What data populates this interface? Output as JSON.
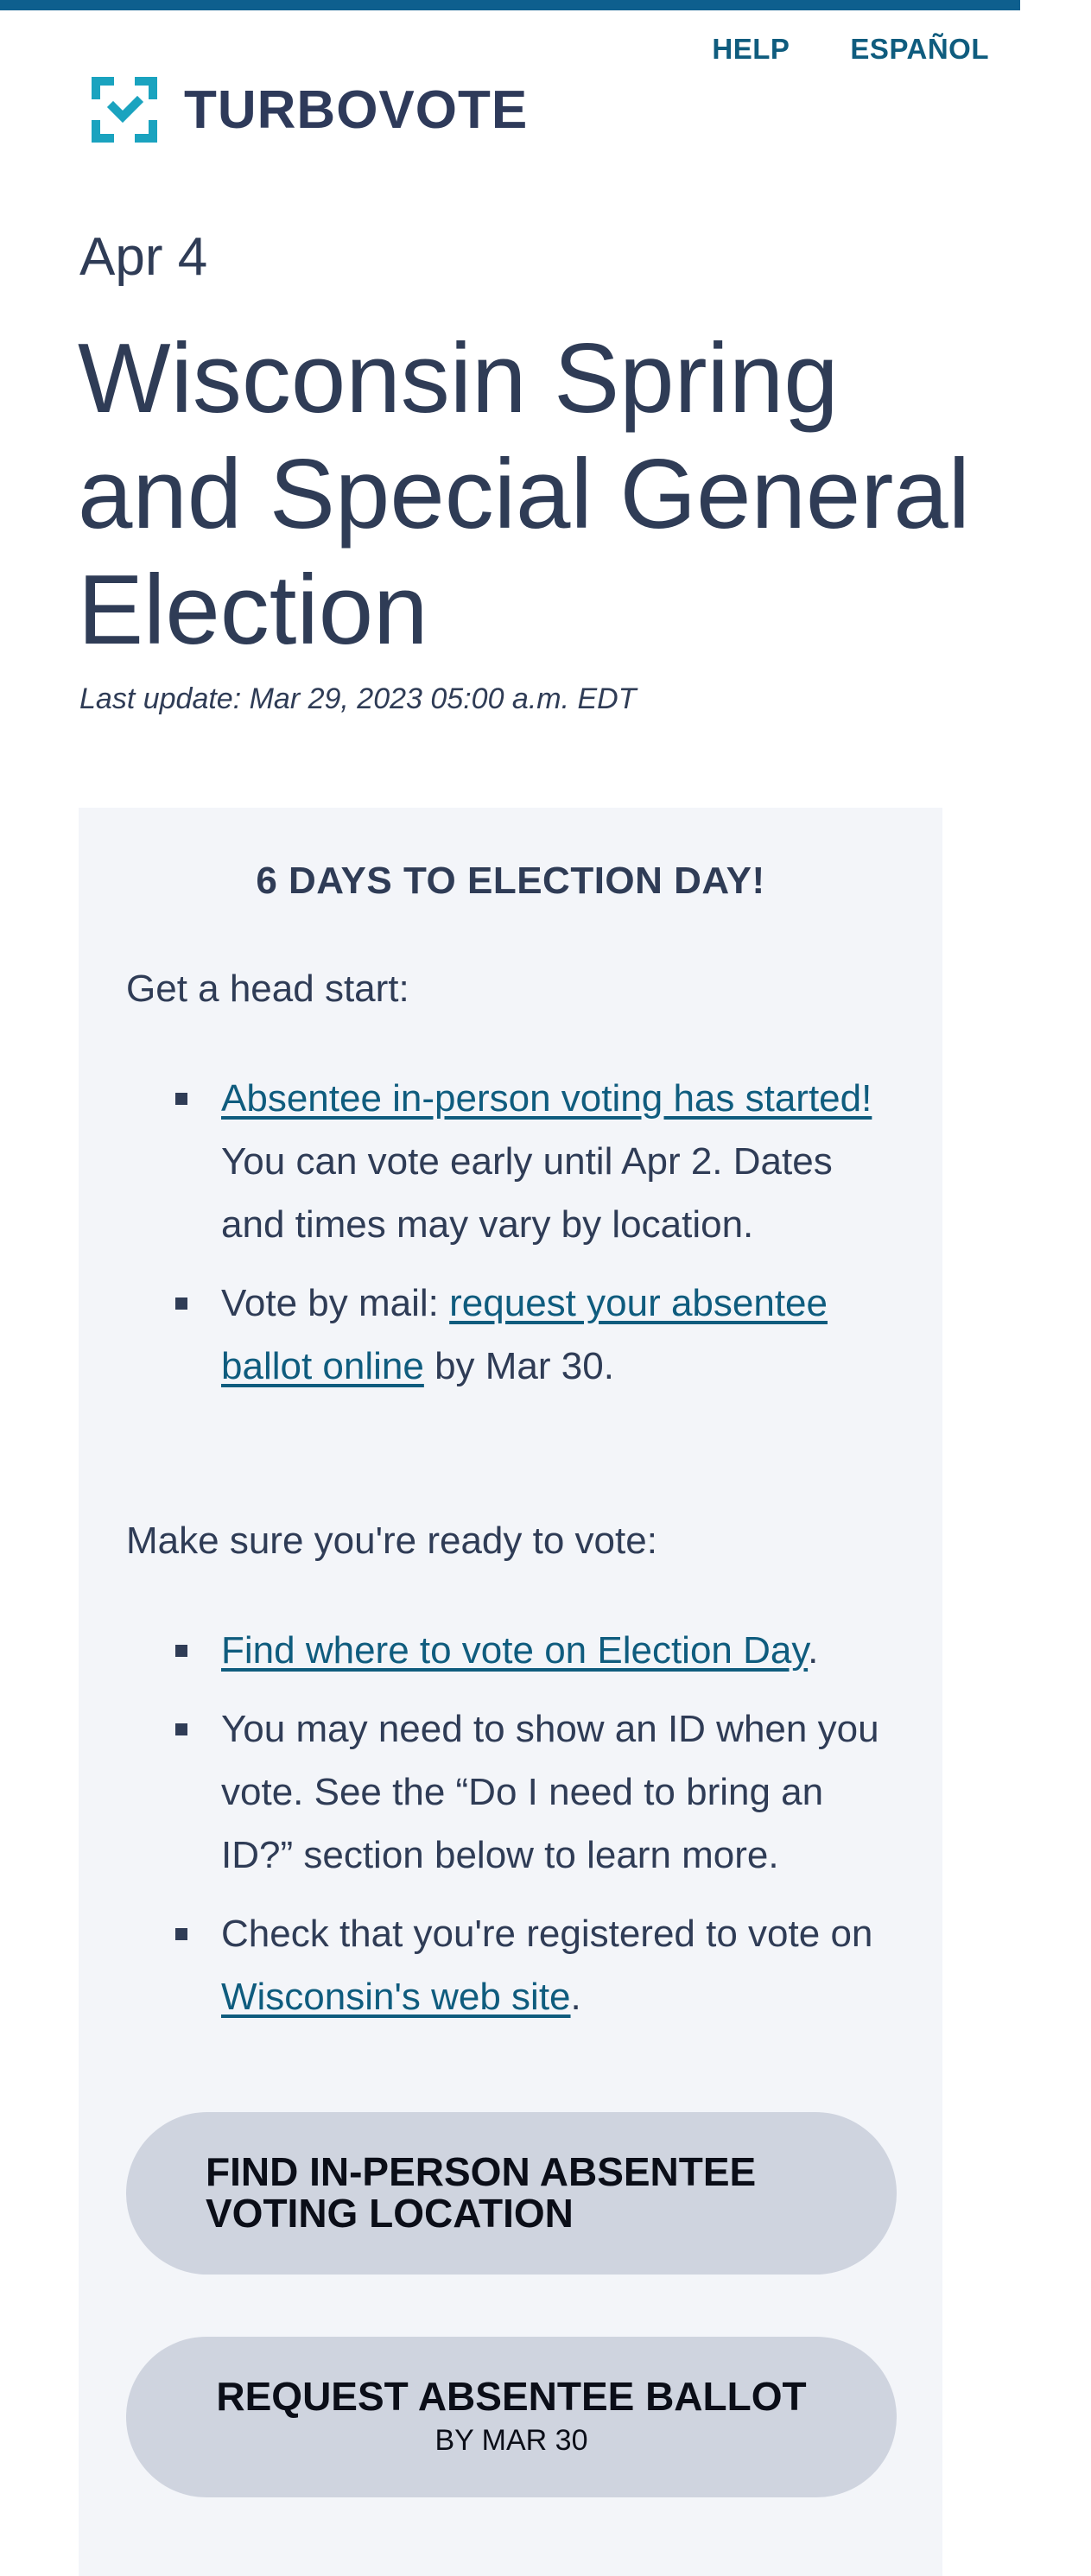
{
  "nav": {
    "help": "HELP",
    "espanol": "ESPAÑOL"
  },
  "logo": {
    "text": "TURBOVOTE",
    "icon": "checkbox-logo-icon",
    "color": "#1aa3bf"
  },
  "election": {
    "date": "Apr 4",
    "title": "Wisconsin Spring and Special General Election",
    "last_update": "Last update: Mar 29, 2023 05:00 a.m. EDT"
  },
  "panel": {
    "heading": "6 DAYS TO ELECTION DAY!",
    "head_start": "Get a head start:",
    "head_start_items": [
      {
        "link": "Absentee in-person voting has started!",
        "text": " You can vote early until Apr 2. Dates and times may vary by location."
      },
      {
        "prefix": "Vote by mail: ",
        "link": "request your absentee ballot online",
        "suffix": " by Mar 30."
      }
    ],
    "ready": "Make sure you're ready to vote:",
    "ready_items": [
      {
        "link": "Find where to vote on Election Day",
        "suffix": "."
      },
      {
        "text": "You may need to show an ID when you vote. See the “Do I need to bring an ID?” section below to learn more."
      },
      {
        "prefix": "Check that you're registered to vote on ",
        "link": "Wisconsin's web site",
        "suffix": "."
      }
    ],
    "buttons": {
      "find_location": "FIND IN-PERSON ABSENTEE VOTING LOCATION",
      "request_ballot": "REQUEST ABSENTEE BALLOT",
      "request_ballot_sub": "BY MAR 30"
    }
  },
  "colors": {
    "stripe": "#0e5f8e",
    "link": "#0f5c7e",
    "text": "#2f3c56",
    "panel_bg": "#f3f5f9",
    "button_bg": "#cfd4df"
  }
}
